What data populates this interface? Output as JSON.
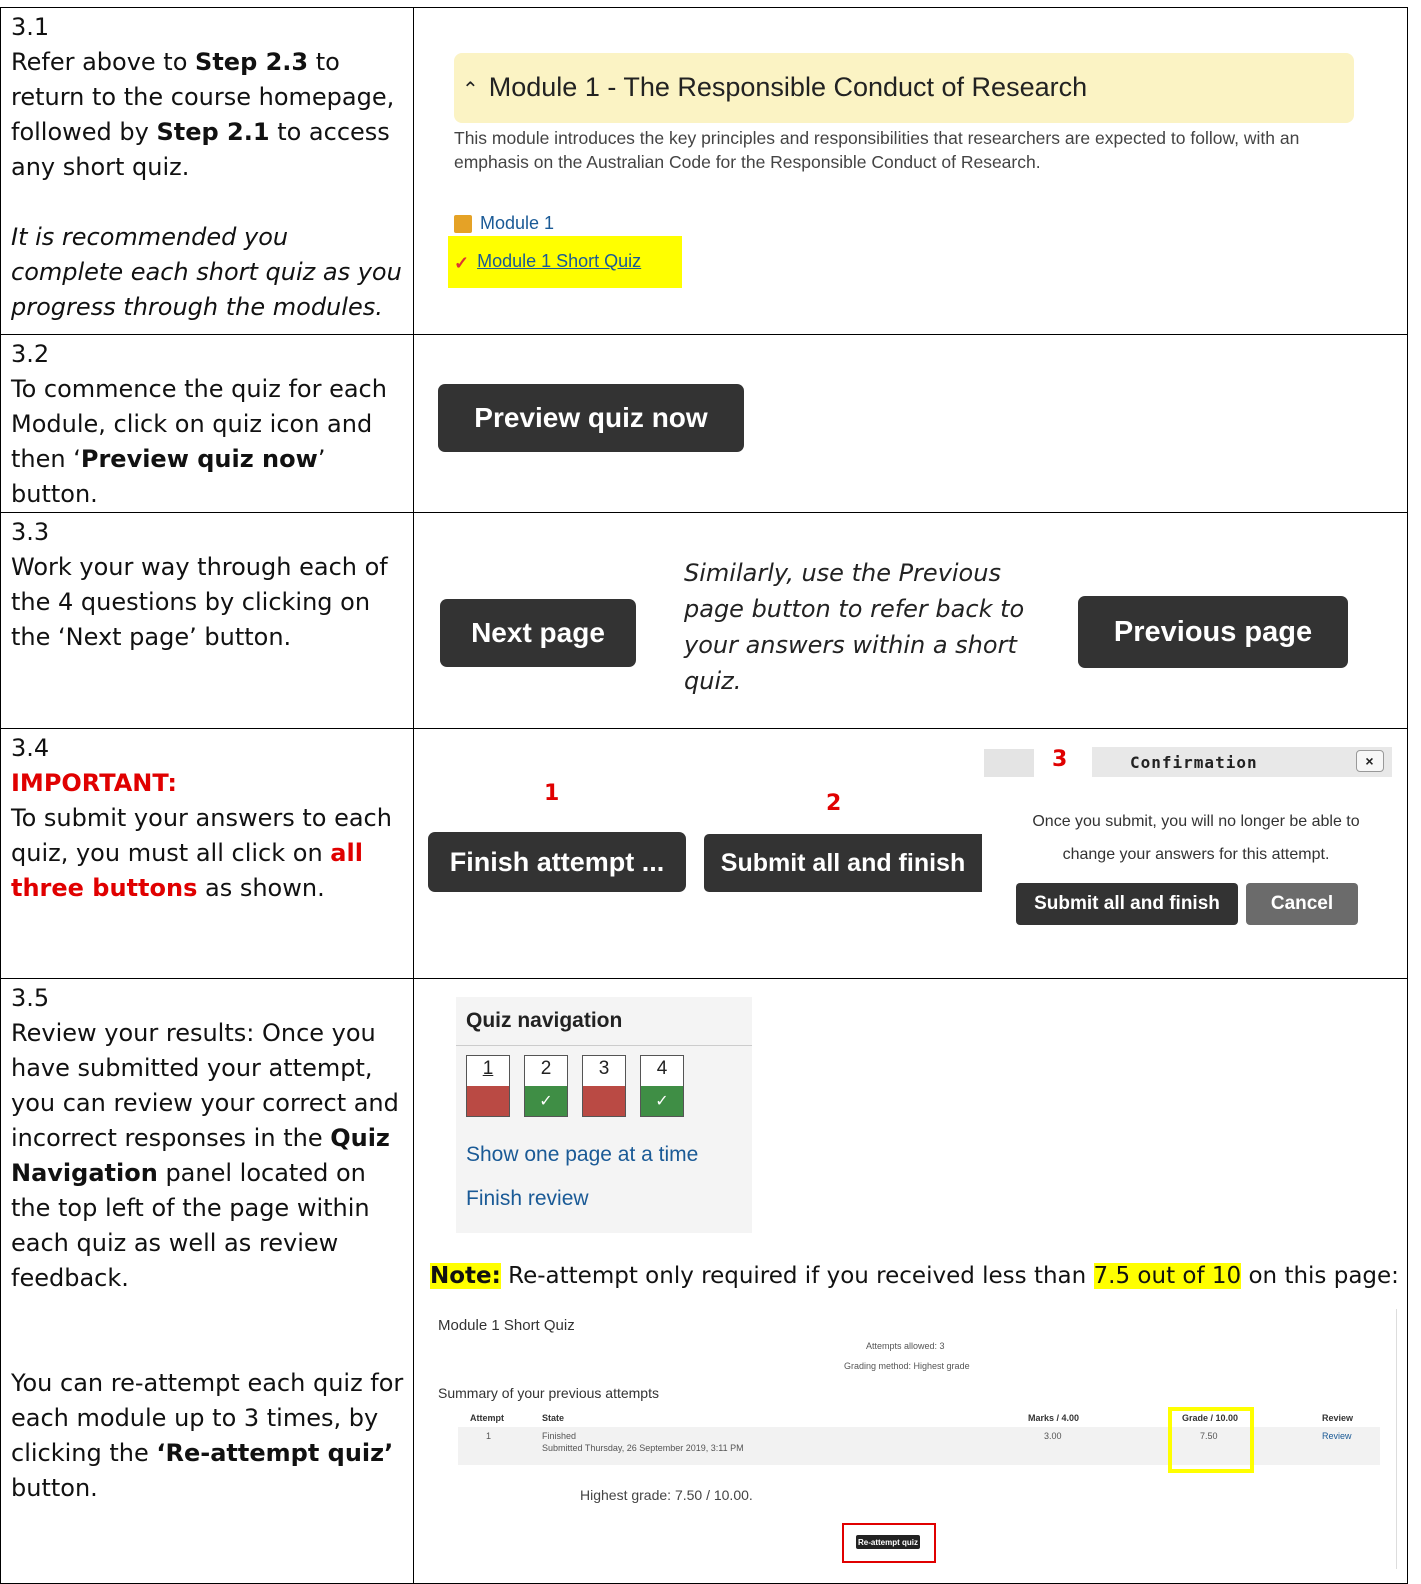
{
  "rows": [
    {
      "step": "3.1",
      "text_1a": "Refer above to ",
      "text_1b": "Step 2.3",
      "text_1c": " to return to the course homepage, followed by ",
      "text_1d": "Step 2.1",
      "text_1e": " to access any short quiz.",
      "italic": "It is recommended you complete each short quiz as you progress through the modules.",
      "module_title": "Module 1 - The Responsible Conduct of Research",
      "module_desc": "This module introduces the key principles and responsibilities that researchers are expected to follow, with an emphasis on the Australian Code for the Responsible Conduct of Research.",
      "link_module": "Module 1",
      "link_quiz": "Module 1 Short Quiz"
    },
    {
      "step": "3.2",
      "text_a": "To commence the quiz for each Module, click on quiz icon and then ‘",
      "text_b": "Preview quiz now",
      "text_c": "’ button.",
      "button": "Preview quiz now"
    },
    {
      "step": "3.3",
      "text": "Work your way through each of the 4 questions by clicking on the ‘Next page’ button.",
      "next_button": "Next page",
      "italic_note": "Similarly, use the Previous page button to refer back to your answers within a short quiz.",
      "prev_button": "Previous page"
    },
    {
      "step": "3.4",
      "important": "IMPORTANT:",
      "text_a": "To submit your answers to each quiz, you must all click on ",
      "text_b": "all three buttons",
      "text_c": " as shown.",
      "num1": "1",
      "num2": "2",
      "num3": "3",
      "finish_button": "Finish attempt ...",
      "submit_button": "Submit all and finish",
      "confirm_title": "Confirmation",
      "confirm_close": "×",
      "confirm_msg1": "Once you submit, you will no longer be able to",
      "confirm_msg2": "change your answers for this attempt.",
      "confirm_submit": "Submit all and finish",
      "confirm_cancel": "Cancel"
    },
    {
      "step": "3.5",
      "text_a": "Review your results: Once you have submitted your attempt, you can review your correct and incorrect responses in the ",
      "text_b": "Quiz Navigation",
      "text_c": " panel located on the top left of the page within each quiz as well as review feedback.",
      "text_d": "You can re-attempt each quiz for each module up to 3 times, by clicking the ",
      "text_e": "‘Re-attempt quiz’",
      "text_f": " button.",
      "qnav_title": "Quiz navigation",
      "questions": [
        {
          "num": "1",
          "state": "incorrect"
        },
        {
          "num": "2",
          "state": "correct"
        },
        {
          "num": "3",
          "state": "incorrect"
        },
        {
          "num": "4",
          "state": "correct"
        }
      ],
      "check": "✓",
      "link_show": "Show one page at a time",
      "link_finish": "Finish review",
      "note_label": "Note:",
      "note_a": " Re-attempt only required if you received less than ",
      "note_b": "7.5 out of 10",
      "note_c": " on this page:",
      "summary": {
        "title": "Module 1 Short Quiz",
        "attempts_allowed": "Attempts allowed: 3",
        "grading_method": "Grading method: Highest grade",
        "subtitle": "Summary of your previous attempts",
        "headers": [
          "Attempt",
          "State",
          "Marks / 4.00",
          "Grade / 10.00",
          "Review"
        ],
        "attempt": "1",
        "state": "Finished",
        "submitted": "Submitted Thursday, 26 September 2019, 3:11 PM",
        "marks": "3.00",
        "grade": "7.50",
        "review": "Review",
        "highest": "Highest grade: 7.50 / 10.00.",
        "reattempt_button": "Re-attempt quiz"
      }
    }
  ],
  "colors": {
    "dark_button": "#333333",
    "highlight": "#ffff00",
    "red": "#e00000",
    "link": "#1a5a96",
    "module_header_bg": "#fbf3c4",
    "incorrect": "#ba4a44",
    "correct": "#3f8e45"
  }
}
